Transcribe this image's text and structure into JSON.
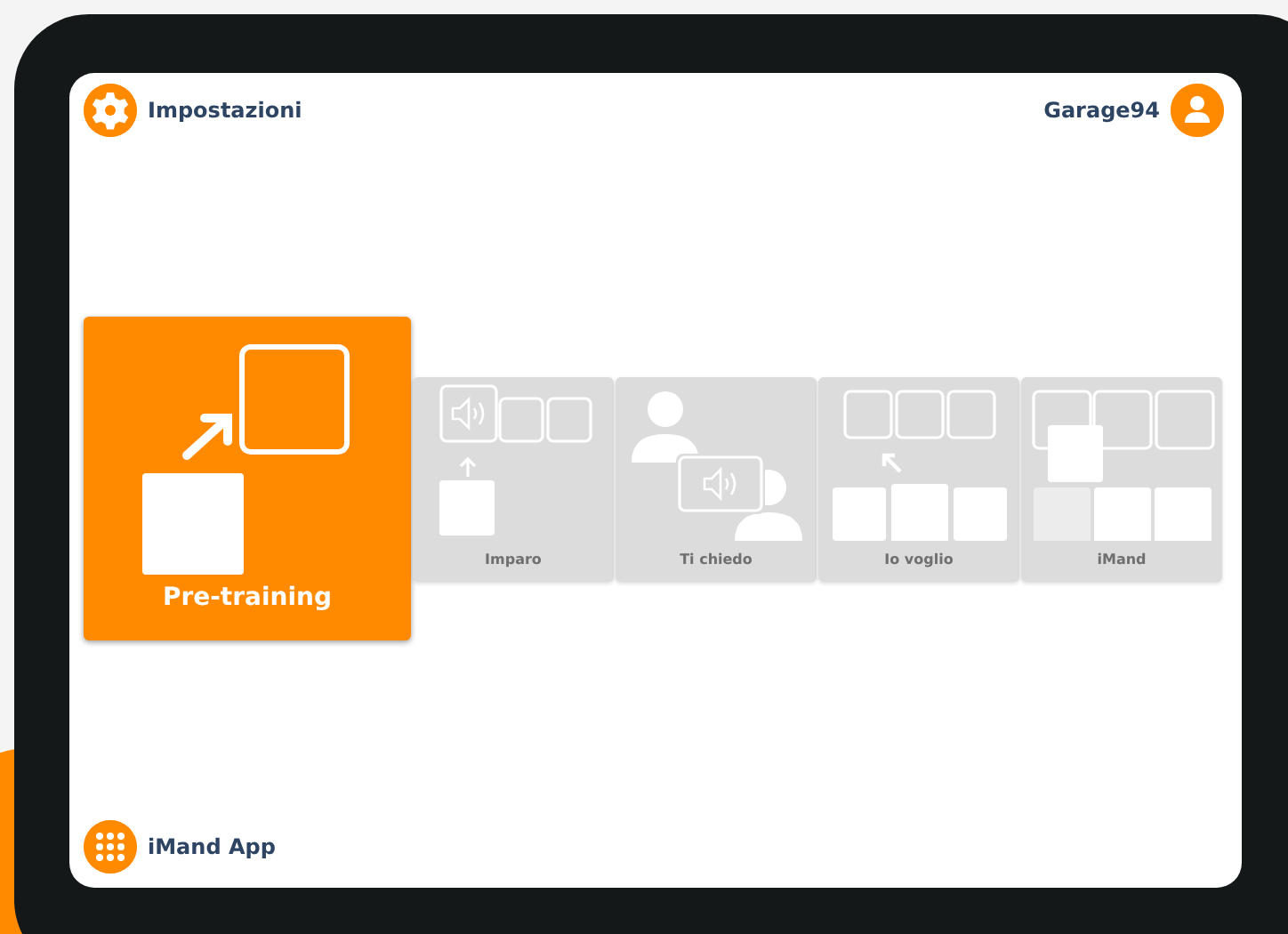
{
  "header": {
    "settings_label": "Impostazioni",
    "user_name": "Garage94"
  },
  "modes": [
    {
      "kind": "pretraining",
      "label": "Pre-training",
      "selected": true
    },
    {
      "kind": "imparo",
      "label": "Imparo",
      "selected": false
    },
    {
      "kind": "ti_chiedo",
      "label": "Ti chiedo",
      "selected": false
    },
    {
      "kind": "io_voglio",
      "label": "Io voglio",
      "selected": false
    },
    {
      "kind": "imand",
      "label": "iMand",
      "selected": false
    }
  ],
  "footer": {
    "app_label": "iMand App"
  }
}
